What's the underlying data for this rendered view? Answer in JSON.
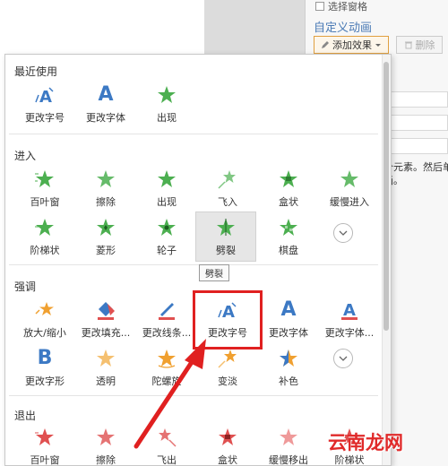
{
  "background": {
    "top_item": "选择窗格",
    "panel_title": "自定义动画",
    "add_effect": "添加效果",
    "delete": "删除",
    "note_line1": "个元素。然后单",
    "note_line2": "画。"
  },
  "sections": {
    "recent": {
      "title": "最近使用",
      "items": [
        {
          "label": "更改字号",
          "icon": "font-size-icon"
        },
        {
          "label": "更改字体",
          "icon": "font-icon"
        },
        {
          "label": "出现",
          "icon": "star-icon"
        }
      ]
    },
    "entrance": {
      "title": "进入",
      "items": [
        {
          "label": "百叶窗"
        },
        {
          "label": "擦除"
        },
        {
          "label": "出现"
        },
        {
          "label": "飞入"
        },
        {
          "label": "盒状"
        },
        {
          "label": "缓慢进入"
        },
        {
          "label": "阶梯状"
        },
        {
          "label": "菱形"
        },
        {
          "label": "轮子"
        },
        {
          "label": "劈裂"
        },
        {
          "label": "棋盘"
        }
      ]
    },
    "emphasis": {
      "title": "强调",
      "items": [
        {
          "label": "放大/缩小"
        },
        {
          "label": "更改填充..."
        },
        {
          "label": "更改线条..."
        },
        {
          "label": "更改字号"
        },
        {
          "label": "更改字体"
        },
        {
          "label": "更改字体..."
        },
        {
          "label": "更改字形"
        },
        {
          "label": "透明"
        },
        {
          "label": "陀螺旋"
        },
        {
          "label": "变淡"
        },
        {
          "label": "补色"
        }
      ]
    },
    "exit": {
      "title": "退出",
      "items": [
        {
          "label": "百叶窗"
        },
        {
          "label": "擦除"
        },
        {
          "label": "飞出"
        },
        {
          "label": "盒状"
        },
        {
          "label": "缓慢移出"
        },
        {
          "label": "阶梯状"
        }
      ]
    }
  },
  "tooltip": "劈裂",
  "watermark": "云南龙网",
  "colors": {
    "green_star": "#4caf50",
    "orange_star": "#f0a030",
    "red_star": "#e05050",
    "blue_letter": "#3c79c4",
    "highlight_red": "#e02020"
  }
}
